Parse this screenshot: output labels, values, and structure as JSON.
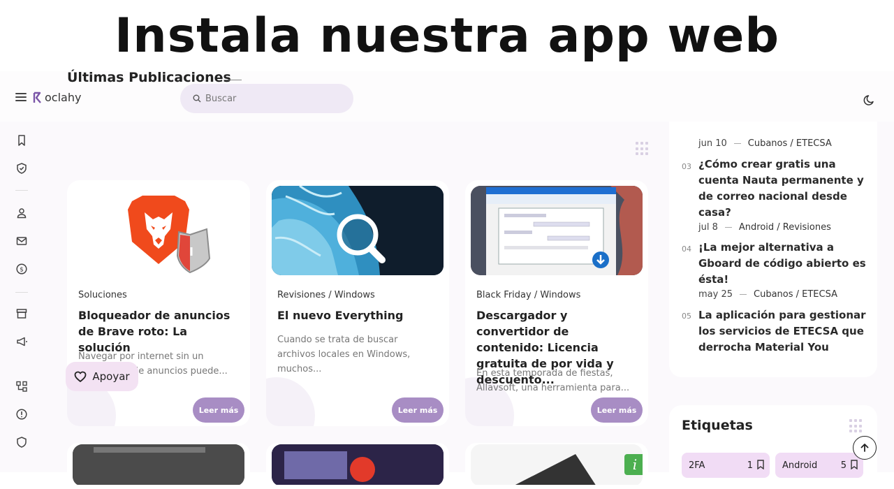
{
  "banner": {
    "title": "Instala nuestra app web"
  },
  "header": {
    "logo_text": "oclahy",
    "search_placeholder": "Buscar"
  },
  "main": {
    "section_title": "Últimas Publicaciones",
    "read_more": "Leer más",
    "cards": [
      {
        "category": "Soluciones",
        "title": "Bloqueador de anuncios de Brave roto: La solución",
        "excerpt": "Navegar por internet sin un bloqueador de anuncios puede..."
      },
      {
        "category": "Revisiones / Windows",
        "title": "El nuevo Everything",
        "excerpt": "Cuando se trata de buscar archivos locales en Windows, muchos..."
      },
      {
        "category": "Black Friday / Windows",
        "title": "Descargador y convertidor de contenido: Licencia gratuita de por vida y descuento...",
        "excerpt": "En esta temporada de fiestas, Allavsoft, una herramienta para..."
      }
    ],
    "support_label": "Apoyar"
  },
  "sidebar_posts": [
    {
      "num": "",
      "date": "jun 10",
      "category": "Cubanos / ETECSA",
      "title": ""
    },
    {
      "num": "03",
      "date": "",
      "category": "",
      "title": "¿Cómo crear gratis una cuenta Nauta permanente y de correo nacional desde casa?"
    },
    {
      "num": "04",
      "date": "jul 8",
      "category": "Android / Revisiones",
      "title": "¡La mejor alternativa a Gboard de código abierto es ésta!"
    },
    {
      "num": "05",
      "date": "may 25",
      "category": "Cubanos / ETECSA",
      "title": "La aplicación para gestionar los servicios de ETECSA que derrocha Material You"
    }
  ],
  "tags": {
    "title": "Etiquetas",
    "items": [
      {
        "label": "2FA",
        "count": "1"
      },
      {
        "label": "Android",
        "count": "5"
      }
    ]
  },
  "colors": {
    "accent": "#a88dc4",
    "tag_bg": "#f1dcf5",
    "search_bg": "#efe9f5"
  }
}
